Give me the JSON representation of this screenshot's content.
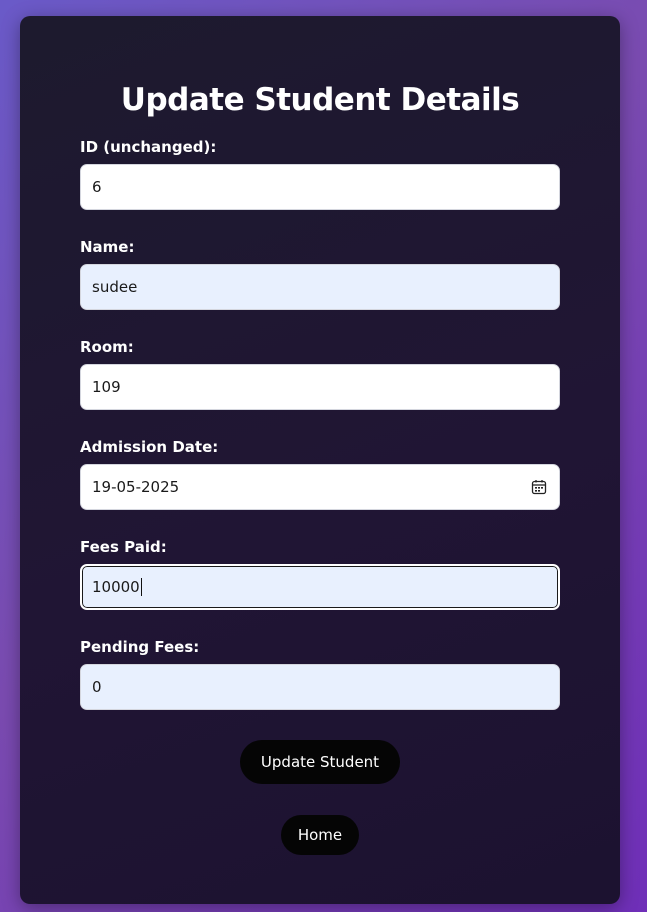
{
  "form": {
    "title": "Update Student Details",
    "fields": [
      {
        "label": "ID (unchanged):",
        "value": "6"
      },
      {
        "label": "Name:",
        "value": "sudee"
      },
      {
        "label": "Room:",
        "value": "109"
      },
      {
        "label": "Admission Date:",
        "value": "19-05-2025",
        "icon": "calendar-icon"
      },
      {
        "label": "Fees Paid:",
        "value": "10000"
      },
      {
        "label": "Pending Fees:",
        "value": "0"
      }
    ],
    "submit_label": "Update Student",
    "home_label": "Home"
  },
  "colors": {
    "background_gradient": [
      "#6a5ac8",
      "#6f2fb8"
    ],
    "card": "#1e1730",
    "autofill_input": "#e8f0fe",
    "button": "#050505"
  }
}
